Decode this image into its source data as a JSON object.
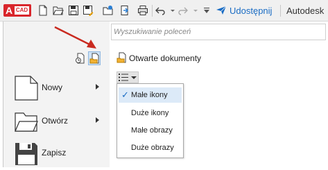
{
  "toolbar": {
    "app_letter": "A",
    "app_badge": "CAD",
    "share_label": "Udostępnij",
    "brand": "Autodesk",
    "accent": "#1a6cc4",
    "icons": [
      "new-file-icon",
      "open-folder-icon",
      "save-icon",
      "save-as-icon",
      "open-web-icon",
      "save-web-icon",
      "plot-icon",
      "undo-icon",
      "redo-icon",
      "customize-dropdown-icon",
      "share-icon"
    ]
  },
  "search": {
    "placeholder": "Wyszukiwanie poleceń"
  },
  "sidebar": {
    "items": [
      {
        "label": "Nowy",
        "icon": "new-document-icon"
      },
      {
        "label": "Otwórz",
        "icon": "folder-icon"
      },
      {
        "label": "Zapisz",
        "icon": "floppy-disk-icon"
      }
    ],
    "toggles": [
      "recent-documents-icon",
      "open-documents-icon"
    ]
  },
  "main": {
    "section_title": "Otwarte dokumenty",
    "view_options": [
      {
        "label": "Małe ikony",
        "selected": true
      },
      {
        "label": "Duże ikony",
        "selected": false
      },
      {
        "label": "Małe obrazy",
        "selected": false
      },
      {
        "label": "Duże obrazy",
        "selected": false
      }
    ]
  }
}
